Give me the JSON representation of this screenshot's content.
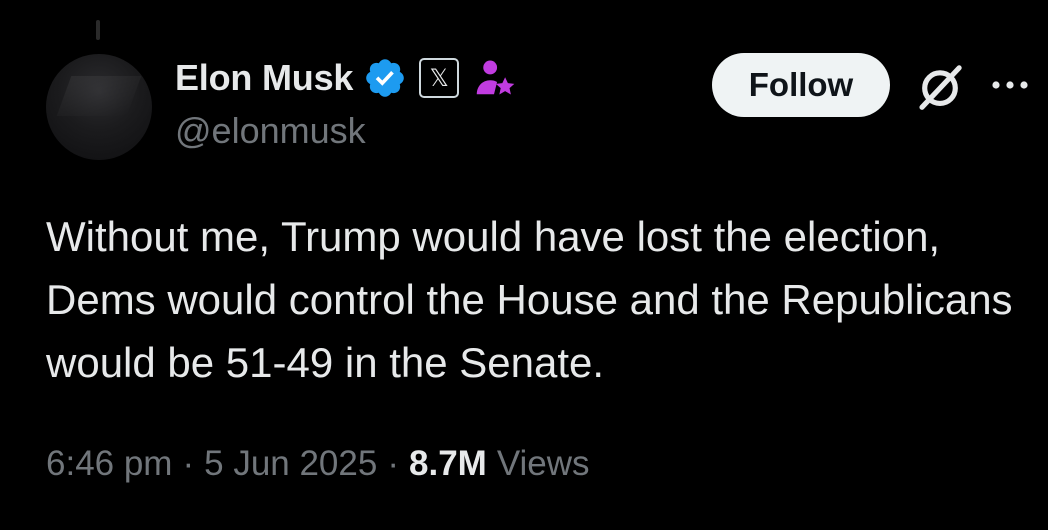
{
  "author": {
    "display_name": "Elon Musk",
    "handle": "@elonmusk",
    "verified_color": "#1d9bf0",
    "affiliate_badge_glyph": "𝕏",
    "extra_badge_icon": "user-star-icon",
    "extra_badge_color": "#c13ce0"
  },
  "actions": {
    "follow_label": "Follow",
    "grok_icon": "grok-icon",
    "more_icon": "more-icon"
  },
  "tweet": {
    "text": "Without me, Trump would have lost the election, Dems would control the House and the Republicans would be 51-49 in the Senate.",
    "time": "6:46 pm",
    "date": "5 Jun 2025",
    "views_count": "8.7M",
    "views_label": "Views",
    "separator": "·"
  },
  "colors": {
    "background": "#000000",
    "primary_text": "#e7e9ea",
    "secondary_text": "#71767b",
    "follow_bg": "#eff3f4"
  }
}
